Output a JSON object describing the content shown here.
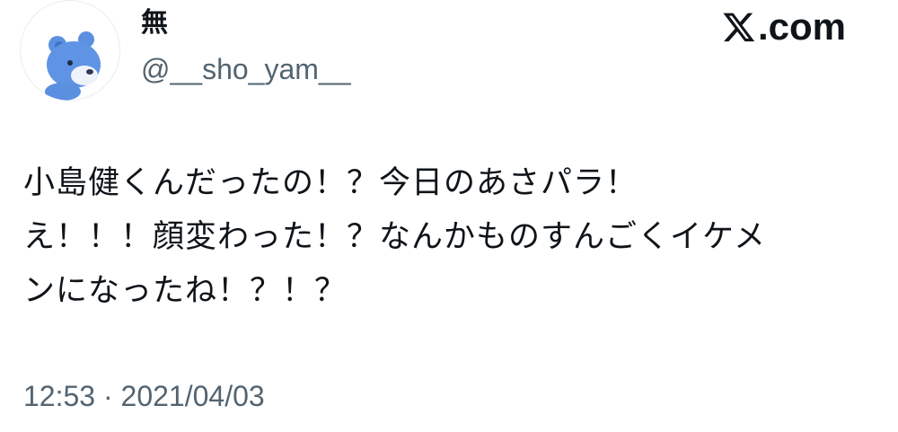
{
  "user": {
    "display_name": "無",
    "handle": "@__sho_yam__",
    "avatar_icon": "blue-bear-avatar-icon"
  },
  "brand": {
    "label": ".com",
    "logo_icon": "x-logo-icon"
  },
  "tweet": {
    "lines": [
      "小島健くんだったの！？今日のあさパラ！",
      "え！！！顔変わった！？なんかものすんごくイケメ",
      "ンになったね！？！？"
    ],
    "timestamp": "12:53 · 2021/04/03"
  },
  "colors": {
    "text_primary": "#0f1419",
    "text_secondary": "#536471",
    "avatar_bear": "#5b8fe0"
  }
}
